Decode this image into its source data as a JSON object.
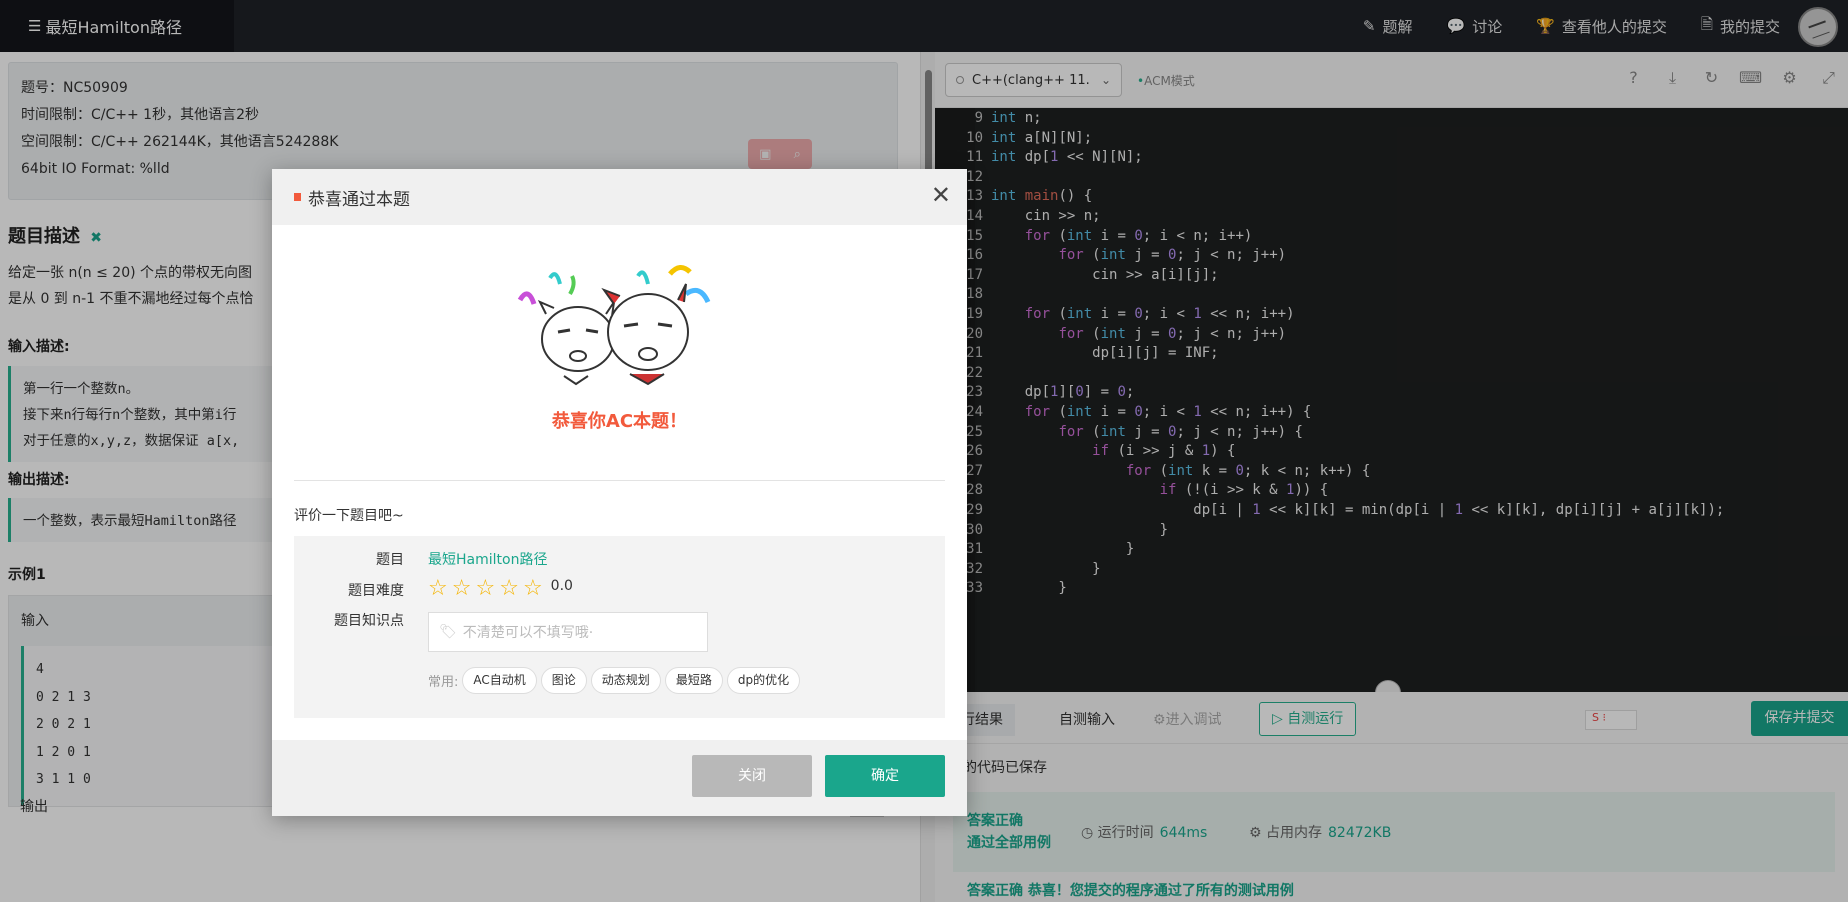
{
  "topbar": {
    "brand": "最短Hamilton路径",
    "nav": [
      {
        "icon": "edit-icon",
        "label": "题解"
      },
      {
        "icon": "chat-bubble-icon",
        "label": "讨论"
      },
      {
        "icon": "trophy-icon",
        "label": "查看他人的提交"
      },
      {
        "icon": "document-icon",
        "label": "我的提交"
      }
    ]
  },
  "problem": {
    "id_line": "题号：NC50909",
    "time_line": "时间限制：C/C++ 1秒，其他语言2秒",
    "memory_line": "空间限制：C/C++ 262144K，其他语言524288K",
    "io_line": "64bit IO Format: %lld",
    "desc_title": "题目描述",
    "desc_line1": "给定一张 n(n ≤ 20) 个点的带权无向图",
    "desc_line2": "是从 0 到 n-1 不重不漏地经过每个点恰",
    "input_title": "输入描述:",
    "input_lines": [
      "第一行一个整数n。",
      "接下来n行每行n个整数，其中第i行",
      "对于任意的x,y,z，数据保证 a[x,"
    ],
    "output_title": "输出描述:",
    "output_lines": [
      "一个整数，表示最短Hamilton路径"
    ],
    "sample_title": "示例1",
    "sample_input_label": "输入",
    "sample_input": [
      "4",
      "0 2 1 3",
      "2 0 2 1",
      "1 2 0 1",
      "3 1 1 0"
    ],
    "sample_output_label": "输出",
    "copy_label": "复制"
  },
  "editor": {
    "language": "C++(clang++ 11.",
    "mode": "ACM模式",
    "code_lines": [
      {
        "n": "9",
        "html": "<span class='ty'>int</span> n;"
      },
      {
        "n": "10",
        "html": "<span class='ty'>int</span> a[N][N];"
      },
      {
        "n": "11",
        "html": "<span class='ty'>int</span> dp[<span class='num'>1</span> << N][N];"
      },
      {
        "n": "12",
        "html": ""
      },
      {
        "n": "13",
        "html": "<span class='ty'>int</span> <span class='fn'>main</span>() {"
      },
      {
        "n": "14",
        "html": "    cin >> n;"
      },
      {
        "n": "15",
        "html": "    <span class='kw'>for</span> (<span class='ty'>int</span> i = <span class='num'>0</span>; i < n; i++)"
      },
      {
        "n": "16",
        "html": "        <span class='kw'>for</span> (<span class='ty'>int</span> j = <span class='num'>0</span>; j < n; j++)"
      },
      {
        "n": "17",
        "html": "            cin >> a[i][j];"
      },
      {
        "n": "18",
        "html": ""
      },
      {
        "n": "19",
        "html": "    <span class='kw'>for</span> (<span class='ty'>int</span> i = <span class='num'>0</span>; i < <span class='num'>1</span> << n; i++)"
      },
      {
        "n": "20",
        "html": "        <span class='kw'>for</span> (<span class='ty'>int</span> j = <span class='num'>0</span>; j < n; j++)"
      },
      {
        "n": "21",
        "html": "            dp[i][j] = INF;"
      },
      {
        "n": "22",
        "html": ""
      },
      {
        "n": "23",
        "html": "    dp[<span class='num'>1</span>][<span class='num'>0</span>] = <span class='num'>0</span>;"
      },
      {
        "n": "24",
        "html": "    <span class='kw'>for</span> (<span class='ty'>int</span> i = <span class='num'>0</span>; i < <span class='num'>1</span> << n; i++) {"
      },
      {
        "n": "25",
        "html": "        <span class='kw'>for</span> (<span class='ty'>int</span> j = <span class='num'>0</span>; j < n; j++) {"
      },
      {
        "n": "26",
        "html": "            <span class='kw'>if</span> (i >> j & <span class='num'>1</span>) {"
      },
      {
        "n": "27",
        "html": "                <span class='kw'>for</span> (<span class='ty'>int</span> k = <span class='num'>0</span>; k < n; k++) {"
      },
      {
        "n": "28",
        "html": "                    <span class='kw'>if</span> (!(i >> k & <span class='num'>1</span>)) {"
      },
      {
        "n": "29",
        "html": "                        dp[i | <span class='num'>1</span> << k][k] = min(dp[i | <span class='num'>1</span> << k][k], dp[i][j] + a[j][k]);"
      },
      {
        "n": "30",
        "html": "                    }"
      },
      {
        "n": "31",
        "html": "                }"
      },
      {
        "n": "32",
        "html": "            }"
      },
      {
        "n": "33",
        "html": "        }"
      }
    ]
  },
  "run": {
    "tab_result": "运行结果",
    "tab_custom_input": "自测输入",
    "tab_debug": "进入调试",
    "self_run": "▷ 自测运行",
    "submit": "保存并提交",
    "saved_text": "的代码已保存",
    "verdict_line1": "答案正确",
    "verdict_line2": "通过全部用例",
    "time_label": "运行时间",
    "time_value": "644ms",
    "mem_label": "占用内存",
    "mem_value": "82472KB",
    "final_text": "答案正确 恭喜！您提交的程序通过了所有的测试用例"
  },
  "modal": {
    "title": "恭喜通过本题",
    "congrats": "恭喜你AC本题！",
    "rate_prompt": "评价一下题目吧~",
    "label_problem": "题目",
    "problem_name": "最短Hamilton路径",
    "label_difficulty": "题目难度",
    "difficulty_score": "0.0",
    "stars_selected": 0,
    "stars_total": 5,
    "label_knowledge": "题目知识点",
    "knowledge_placeholder": "不清楚可以不填写哦·",
    "common_label": "常用:",
    "common_tags": [
      "AC自动机",
      "图论",
      "动态规划",
      "最短路",
      "dp的优化"
    ],
    "close_label": "关闭",
    "ok_label": "确定"
  },
  "colors": {
    "accent": "#1aa68c",
    "congrats": "#f25a3c",
    "star": "#f5b400",
    "topbar": "#1f2228"
  }
}
